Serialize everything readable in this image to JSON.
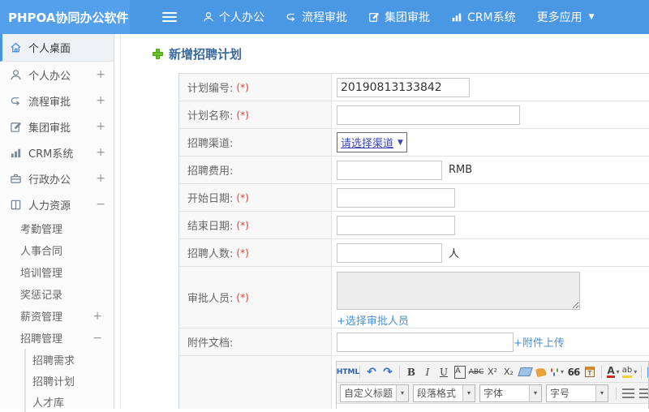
{
  "topbar": {
    "brand": "PHPOA协同办公软件",
    "menu": [
      {
        "label": "个人办公"
      },
      {
        "label": "流程审批"
      },
      {
        "label": "集团审批"
      },
      {
        "label": "CRM系统"
      },
      {
        "label": "更多应用",
        "caret": "▼"
      }
    ]
  },
  "sidebar": {
    "items": [
      {
        "label": "个人桌面"
      },
      {
        "label": "个人办公",
        "expand": "+"
      },
      {
        "label": "流程审批",
        "expand": "+"
      },
      {
        "label": "集团审批",
        "expand": "+"
      },
      {
        "label": "CRM系统",
        "expand": "+"
      },
      {
        "label": "行政办公",
        "expand": "+"
      },
      {
        "label": "人力资源",
        "expand": "−"
      }
    ],
    "hr_children": [
      {
        "label": "考勤管理"
      },
      {
        "label": "人事合同"
      },
      {
        "label": "培训管理"
      },
      {
        "label": "奖惩记录"
      },
      {
        "label": "薪资管理",
        "expand": "+"
      },
      {
        "label": "招聘管理",
        "expand": "−"
      }
    ],
    "recruit_children": [
      {
        "label": "招聘需求"
      },
      {
        "label": "招聘计划"
      },
      {
        "label": "人才库"
      }
    ]
  },
  "page": {
    "title": "新增招聘计划"
  },
  "form": {
    "required_mark": "(*)",
    "plan_no": {
      "label": "计划编号:",
      "value": "20190813133842"
    },
    "plan_name": {
      "label": "计划名称:"
    },
    "channel": {
      "label": "招聘渠道:",
      "selected": "请选择渠道",
      "caret": "▼"
    },
    "fee": {
      "label": "招聘费用:",
      "suffix": "RMB"
    },
    "start_date": {
      "label": "开始日期:"
    },
    "end_date": {
      "label": "结束日期:"
    },
    "headcount": {
      "label": "招聘人数:",
      "suffix": "人"
    },
    "approver": {
      "label": "审批人员:",
      "link": "+选择审批人员"
    },
    "attachment": {
      "label": "附件文档:",
      "link": "+附件上传"
    }
  },
  "editor": {
    "buttons": {
      "html": "HTML",
      "undo": "↶",
      "redo": "↷",
      "bold": "B",
      "italic": "I",
      "underline": "U",
      "boxedA": "A",
      "strike": "ABC",
      "sup": "X²",
      "sub": "X₂",
      "quote": "66",
      "paste_t": "T",
      "fontcolor": "A",
      "highlight": "ab",
      "caret": "▾",
      "chain": "∞"
    },
    "selects": [
      {
        "label": "自定义标题"
      },
      {
        "label": "段落格式"
      },
      {
        "label": "字体"
      },
      {
        "label": "字号"
      }
    ]
  },
  "colors": {
    "topbar_blue": "#4a97e4",
    "brand_blue": "#55a0ea",
    "accent_blue": "#4893e2",
    "title_blue": "#3b6a9b",
    "link_blue": "#4a90d9",
    "required_red": "#e53c2e",
    "plus_green": "#6cbf2e"
  }
}
